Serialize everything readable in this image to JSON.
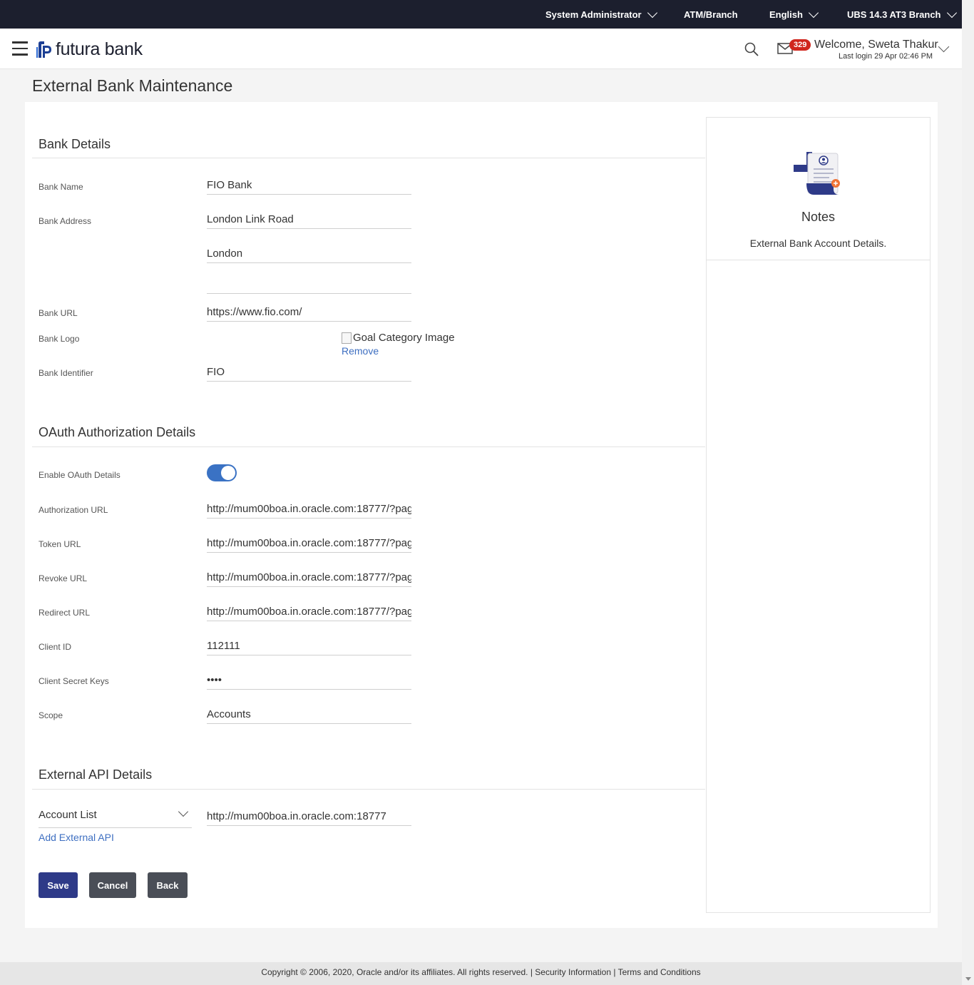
{
  "topbar": {
    "role": "System Administrator",
    "branch": "ATM/Branch",
    "language": "English",
    "version": "UBS 14.3 AT3 Branch"
  },
  "header": {
    "brand": "futura bank",
    "notification_count": "329",
    "welcome": "Welcome, Sweta Thakur",
    "last_login": "Last login 29 Apr 02:46 PM"
  },
  "page": {
    "title": "External Bank Maintenance"
  },
  "bank_details": {
    "section_title": "Bank Details",
    "bank_name_label": "Bank Name",
    "bank_name": "FIO Bank",
    "bank_address_label": "Bank Address",
    "address_line1": "London Link Road",
    "address_line2": "London",
    "address_line3": "",
    "bank_url_label": "Bank URL",
    "bank_url": "https://www.fio.com/",
    "bank_logo_label": "Bank Logo",
    "logo_alt": "Goal Category Image",
    "remove_label": "Remove",
    "bank_identifier_label": "Bank Identifier",
    "bank_identifier": "FIO"
  },
  "oauth": {
    "section_title": "OAuth Authorization Details",
    "enable_label": "Enable OAuth Details",
    "enabled": true,
    "authorization_url_label": "Authorization URL",
    "authorization_url": "http://mum00boa.in.oracle.com:18777/?pag",
    "token_url_label": "Token URL",
    "token_url": "http://mum00boa.in.oracle.com:18777/?pag",
    "revoke_url_label": "Revoke URL",
    "revoke_url": "http://mum00boa.in.oracle.com:18777/?pag",
    "redirect_url_label": "Redirect URL",
    "redirect_url": "http://mum00boa.in.oracle.com:18777/?pag",
    "client_id_label": "Client ID",
    "client_id": "112111",
    "client_secret_label": "Client Secret Keys",
    "client_secret": "••••",
    "scope_label": "Scope",
    "scope": "Accounts"
  },
  "external_api": {
    "section_title": "External API Details",
    "api_type": "Account List",
    "api_url": "http://mum00boa.in.oracle.com:18777",
    "add_label": "Add External API"
  },
  "actions": {
    "save": "Save",
    "cancel": "Cancel",
    "back": "Back"
  },
  "notes": {
    "title": "Notes",
    "text": "External Bank Account Details."
  },
  "footer": {
    "copyright": "Copyright © 2006, 2020, Oracle and/or its affiliates. All rights reserved.",
    "security": "Security Information",
    "terms": "Terms and Conditions"
  },
  "colors": {
    "topbar": "#1c1f2e",
    "primary_button": "#2e3a88",
    "secondary_button": "#4a4e57",
    "link": "#3e6fc1",
    "toggle_on": "#3a72c4",
    "badge": "#d0261d"
  },
  "icons": [
    "hamburger-icon",
    "futura-logo-icon",
    "search-icon",
    "mail-icon",
    "chevron-down-icon",
    "notes-icon",
    "broken-image-icon"
  ]
}
